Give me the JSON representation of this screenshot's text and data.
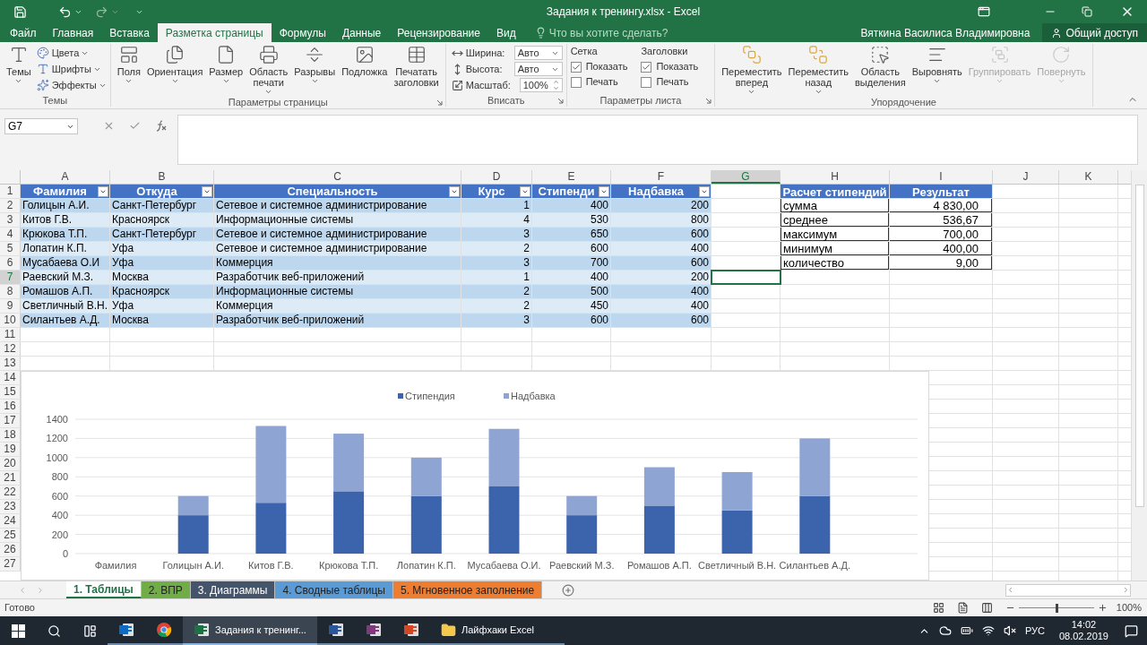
{
  "title_bar": {
    "title": "Задания к тренингу.xlsx - Excel"
  },
  "tabs": [
    {
      "label": "Файл",
      "selected": false
    },
    {
      "label": "Главная",
      "selected": false
    },
    {
      "label": "Вставка",
      "selected": false
    },
    {
      "label": "Разметка страницы",
      "selected": true
    },
    {
      "label": "Формулы",
      "selected": false
    },
    {
      "label": "Данные",
      "selected": false
    },
    {
      "label": "Рецензирование",
      "selected": false
    },
    {
      "label": "Вид",
      "selected": false
    }
  ],
  "tell_me": {
    "placeholder": "Что вы хотите сделать?"
  },
  "user": "Вяткина Василиса Владимировна",
  "share": "Общий доступ",
  "ribbon": {
    "groups": [
      {
        "label": "Темы",
        "launcher": false,
        "items": [
          {
            "kind": "large",
            "label": "Темы",
            "caret": true,
            "disabled": false
          },
          {
            "kind": "small",
            "label": "Цвета",
            "caret": true
          },
          {
            "kind": "small",
            "label": "Шрифты",
            "caret": true
          },
          {
            "kind": "small",
            "label": "Эффекты",
            "caret": true
          }
        ]
      },
      {
        "label": "Параметры страницы",
        "launcher": true,
        "items": [
          {
            "kind": "large",
            "label": "Поля",
            "caret": true,
            "disabled": false
          },
          {
            "kind": "large",
            "label": "Ориентация",
            "caret": true,
            "disabled": false
          },
          {
            "kind": "large",
            "label": "Размер",
            "caret": true,
            "disabled": false
          },
          {
            "kind": "large",
            "label": "Область печати",
            "caret": true,
            "disabled": false
          },
          {
            "kind": "large",
            "label": "Разрывы",
            "caret": true,
            "disabled": false
          },
          {
            "kind": "large",
            "label": "Подложка",
            "caret": false,
            "disabled": false
          },
          {
            "kind": "large",
            "label": "Печатать заголовки",
            "caret": false,
            "disabled": false
          }
        ]
      },
      {
        "label": "Вписать",
        "launcher": true,
        "items": [
          {
            "kind": "dropdown",
            "label": "Ширина:",
            "value": "Авто"
          },
          {
            "kind": "dropdown",
            "label": "Высота:",
            "value": "Авто"
          },
          {
            "kind": "spinner",
            "label": "Масштаб:",
            "value": "100%"
          }
        ]
      },
      {
        "label": "Параметры листа",
        "launcher": true,
        "items": [
          {
            "kind": "checks",
            "label": "Сетка",
            "options": [
              {
                "label": "Показать",
                "checked": true
              },
              {
                "label": "Печать",
                "checked": false
              }
            ]
          },
          {
            "kind": "checks",
            "label": "Заголовки",
            "options": [
              {
                "label": "Показать",
                "checked": true
              },
              {
                "label": "Печать",
                "checked": false
              }
            ]
          }
        ]
      },
      {
        "label": "Упорядочение",
        "launcher": false,
        "items": [
          {
            "kind": "large",
            "label": "Переместить вперед",
            "caret": true,
            "disabled": false
          },
          {
            "kind": "large",
            "label": "Переместить назад",
            "caret": true,
            "disabled": false
          },
          {
            "kind": "large",
            "label": "Область выделения",
            "caret": false,
            "disabled": false
          },
          {
            "kind": "large",
            "label": "Выровнять",
            "caret": true,
            "disabled": false
          },
          {
            "kind": "large",
            "label": "Группировать",
            "caret": true,
            "disabled": true
          },
          {
            "kind": "large",
            "label": "Повернуть",
            "caret": true,
            "disabled": true
          }
        ]
      }
    ]
  },
  "formula_bar": {
    "name_box": "G7"
  },
  "sheet": {
    "columns": [
      {
        "label": "A",
        "selected": false
      },
      {
        "label": "B",
        "selected": false
      },
      {
        "label": "C",
        "selected": false
      },
      {
        "label": "D",
        "selected": false
      },
      {
        "label": "E",
        "selected": false
      },
      {
        "label": "F",
        "selected": false
      },
      {
        "label": "G",
        "selected": true
      },
      {
        "label": "H",
        "selected": false
      },
      {
        "label": "I",
        "selected": false
      },
      {
        "label": "J",
        "selected": false
      },
      {
        "label": "K",
        "selected": false
      }
    ],
    "row_headers": [
      {
        "label": "1",
        "selected": false
      },
      {
        "label": "2",
        "selected": false
      },
      {
        "label": "3",
        "selected": false
      },
      {
        "label": "4",
        "selected": false
      },
      {
        "label": "5",
        "selected": false
      },
      {
        "label": "6",
        "selected": false
      },
      {
        "label": "7",
        "selected": true
      },
      {
        "label": "8",
        "selected": false
      },
      {
        "label": "9",
        "selected": false
      },
      {
        "label": "10",
        "selected": false
      },
      {
        "label": "11",
        "selected": false
      },
      {
        "label": "12",
        "selected": false
      },
      {
        "label": "13",
        "selected": false
      },
      {
        "label": "14",
        "selected": false
      },
      {
        "label": "15",
        "selected": false
      },
      {
        "label": "16",
        "selected": false
      },
      {
        "label": "17",
        "selected": false
      },
      {
        "label": "18",
        "selected": false
      },
      {
        "label": "19",
        "selected": false
      },
      {
        "label": "20",
        "selected": false
      },
      {
        "label": "21",
        "selected": false
      },
      {
        "label": "22",
        "selected": false
      },
      {
        "label": "23",
        "selected": false
      },
      {
        "label": "24",
        "selected": false
      },
      {
        "label": "25",
        "selected": false
      },
      {
        "label": "26",
        "selected": false
      },
      {
        "label": "27",
        "selected": false
      }
    ]
  },
  "table": {
    "columns": [
      {
        "label": "Фамилия",
        "kind": "text"
      },
      {
        "label": "Откуда",
        "kind": "text"
      },
      {
        "label": "Специальность",
        "kind": "text"
      },
      {
        "label": "Курс",
        "kind": "number"
      },
      {
        "label": "Стипенди",
        "kind": "number"
      },
      {
        "label": "Надбавка",
        "kind": "number"
      }
    ],
    "rows": [
      [
        "Голицын А.И.",
        "Санкт-Петербург",
        "Сетевое и системное администрирование",
        "1",
        "400",
        "200"
      ],
      [
        "Китов Г.В.",
        "Красноярск",
        "Информационные системы",
        "4",
        "530",
        "800"
      ],
      [
        "Крюкова Т.П.",
        "Санкт-Петербург",
        "Сетевое и системное администрирование",
        "3",
        "650",
        "600"
      ],
      [
        "Лопатин К.П.",
        "Уфа",
        "Сетевое и системное администрирование",
        "2",
        "600",
        "400"
      ],
      [
        "Мусабаева О.И",
        "Уфа",
        "Коммерция",
        "3",
        "700",
        "600"
      ],
      [
        "Раевский М.З.",
        "Москва",
        "Разработчик веб-приложений",
        "1",
        "400",
        "200"
      ],
      [
        "Ромашов А.П.",
        "Красноярск",
        "Информационные системы",
        "2",
        "500",
        "400"
      ],
      [
        "Светличный В.Н.",
        "Уфа",
        "Коммерция",
        "2",
        "450",
        "400"
      ],
      [
        "Силантьев А.Д.",
        "Москва",
        "Разработчик веб-приложений",
        "3",
        "600",
        "600"
      ]
    ]
  },
  "summary": {
    "columns": [
      "Расчет стипендий",
      "Результат"
    ],
    "rows": [
      [
        "сумма",
        "4 830,00"
      ],
      [
        "среднее",
        "536,67"
      ],
      [
        "максимум",
        "700,00"
      ],
      [
        "минимум",
        "400,00"
      ],
      [
        "количество",
        "9,00"
      ]
    ]
  },
  "chart_data": {
    "type": "bar",
    "stacked": true,
    "orientation": "vertical",
    "categories": [
      "Фамилия",
      "Голицын А.И.",
      "Китов Г.В.",
      "Крюкова Т.П.",
      "Лопатин К.П.",
      "Мусабаева О.И.",
      "Раевский М.З.",
      "Ромашов А.П.",
      "Светличный В.Н.",
      "Силантьев А.Д."
    ],
    "series": [
      {
        "name": "Стипендия",
        "color": "#3c64ad",
        "values": [
          null,
          400,
          530,
          650,
          600,
          700,
          400,
          500,
          450,
          600
        ]
      },
      {
        "name": "Надбавка",
        "color": "#8ea5d4",
        "values": [
          null,
          200,
          800,
          600,
          400,
          600,
          200,
          400,
          400,
          600
        ]
      }
    ],
    "ylim": [
      0,
      1400
    ],
    "grid": true,
    "legend": true,
    "yticks": [
      0,
      200,
      400,
      600,
      800,
      1000,
      1200,
      1400
    ]
  },
  "sheet_tabs": [
    {
      "label": "1. Таблицы",
      "selected": true,
      "color": "#ffffff"
    },
    {
      "label": "2. ВПР",
      "selected": false,
      "color": "#70ad47"
    },
    {
      "label": "3. Диаграммы",
      "selected": false,
      "color": "#44546a"
    },
    {
      "label": "4. Сводные таблицы",
      "selected": false,
      "color": "#5b9bd5"
    },
    {
      "label": "5. Мгновенное заполнение",
      "selected": false,
      "color": "#ed7d31"
    }
  ],
  "status_bar": {
    "status": "Готово",
    "zoom": {
      "level": 0.5,
      "reading": "100%"
    }
  },
  "taskbar": {
    "apps": [
      {
        "kind": "mail",
        "active": false
      },
      {
        "kind": "browser",
        "active": false
      },
      {
        "kind": "sheet",
        "label": "Задания к тренинг...",
        "active": true
      },
      {
        "kind": "doc",
        "active": false
      },
      {
        "kind": "note",
        "active": false
      },
      {
        "kind": "slides",
        "active": false
      },
      {
        "kind": "folder",
        "label": "Лайфхаки Excel",
        "active": false
      }
    ],
    "language": "РУС",
    "time": "14:02",
    "date": "08.02.2019"
  }
}
